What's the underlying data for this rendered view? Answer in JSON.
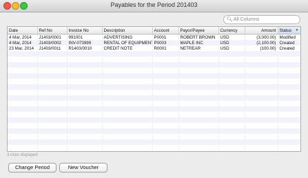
{
  "window": {
    "title": "Payables for the Period 201403"
  },
  "search": {
    "placeholder": "All Columns",
    "icon": "search-icon"
  },
  "table": {
    "columns": [
      "Date",
      "Ref No",
      "Invoice No",
      "Description",
      "Account",
      "Payor/Payee",
      "Currency",
      "Amount",
      "Status"
    ],
    "sorted_column": "Status",
    "rows": [
      [
        "4 Mar, 2014",
        "J1403/0001",
        "991001",
        "ADVERTISING",
        "P0001",
        "ROBERT BROWN",
        "USD",
        "(3,000.00)",
        "Modified"
      ],
      [
        "4 Mar, 2014",
        "J1403/0002",
        "INV-073999",
        "RENTAL OF EQUIPMENT",
        "P0003",
        "MAPLE INC",
        "USD",
        "(2,100.00)",
        "Created"
      ],
      [
        "23 Mar, 2014",
        "J1403/0011",
        "R1403/0010",
        "CREDIT NOTE",
        "R0001",
        "NETREAR",
        "USD",
        "(100.00)",
        "Created"
      ]
    ]
  },
  "status_text": "3 rows displayed",
  "buttons": {
    "change_period": "Change Period",
    "new_voucher": "New Voucher"
  }
}
